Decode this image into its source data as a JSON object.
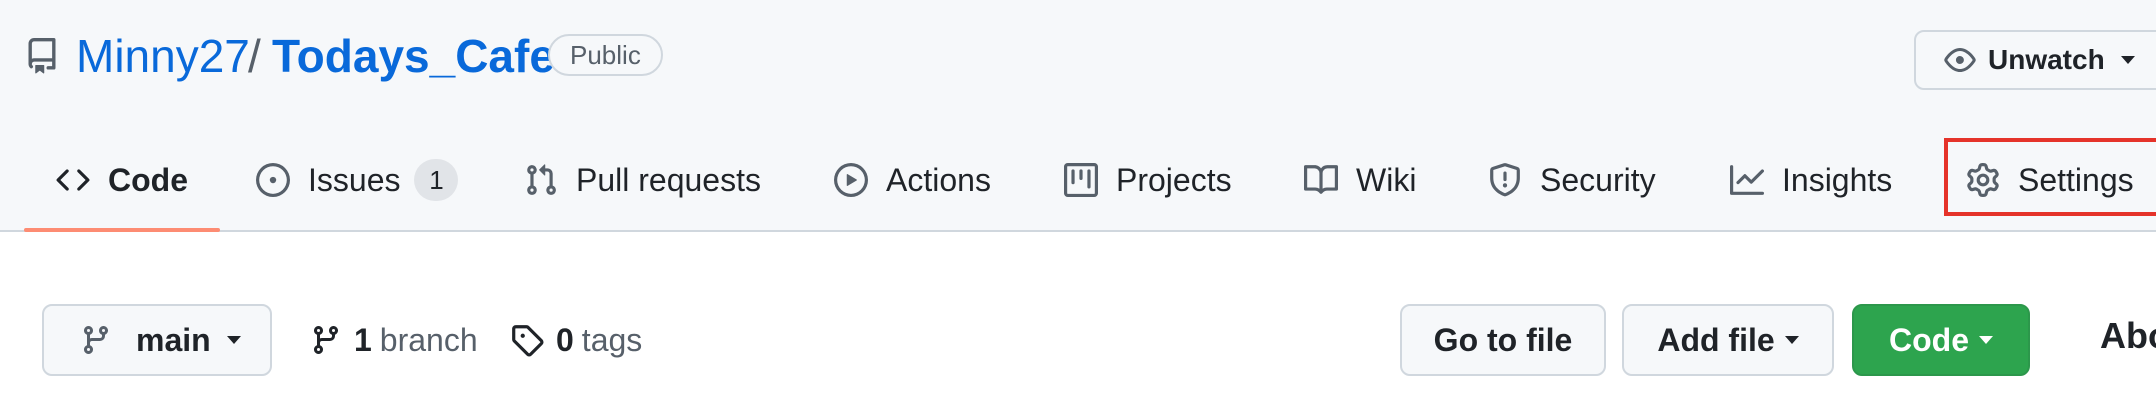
{
  "repo": {
    "owner": "Minny27",
    "separator": "/",
    "name": "Todays_Cafe",
    "visibility": "Public",
    "icon": "repo-icon"
  },
  "watch": {
    "label": "Unwatch",
    "icon": "eye-icon"
  },
  "tabs": [
    {
      "label": "Code",
      "icon": "code-icon",
      "active": true
    },
    {
      "label": "Issues",
      "icon": "issue-opened-icon",
      "count": "1"
    },
    {
      "label": "Pull requests",
      "icon": "git-pull-request-icon"
    },
    {
      "label": "Actions",
      "icon": "play-icon"
    },
    {
      "label": "Projects",
      "icon": "table-icon"
    },
    {
      "label": "Wiki",
      "icon": "book-icon"
    },
    {
      "label": "Security",
      "icon": "shield-icon"
    },
    {
      "label": "Insights",
      "icon": "graph-icon"
    },
    {
      "label": "Settings",
      "icon": "gear-icon",
      "highlighted": true
    }
  ],
  "toolbar": {
    "branch": "main",
    "branch_count": "1",
    "branch_label": "branch",
    "tag_count": "0",
    "tag_label": "tags",
    "go_to_file": "Go to file",
    "add_file": "Add file",
    "code": "Code"
  },
  "sidebar": {
    "about_heading": "Abo"
  },
  "colors": {
    "link": "#0969da",
    "active_tab_underline": "#fd8c73",
    "highlight_box": "#e5332a",
    "code_button": "#2da44e"
  }
}
